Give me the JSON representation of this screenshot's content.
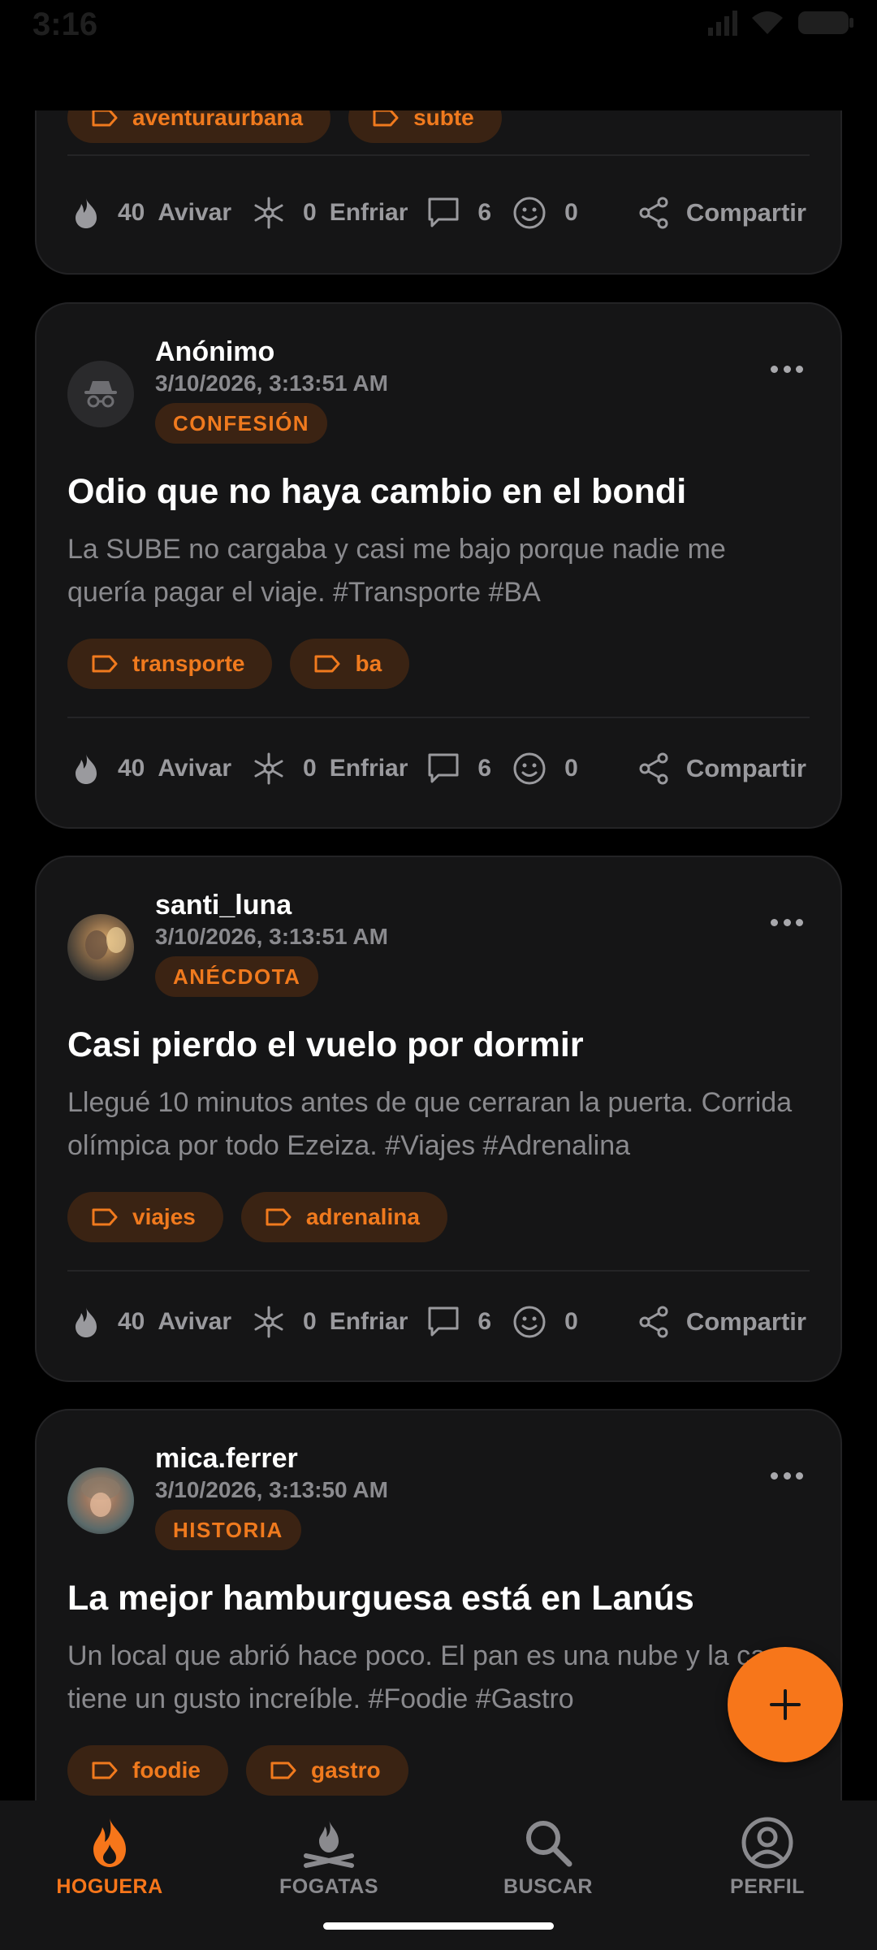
{
  "status_bar": {
    "time": "3:16"
  },
  "posts": [
    {
      "partial": true,
      "tags": [
        "aventuraurbana",
        "subte"
      ],
      "likes": "40",
      "like_label": "Avivar",
      "cools": "0",
      "cool_label": "Enfriar",
      "comments": "6",
      "reactions": "0",
      "share_label": "Compartir"
    },
    {
      "author": "Anónimo",
      "avatar": "incognito-icon",
      "timestamp": "3/10/2026, 3:13:51 AM",
      "category": "CONFESIÓN",
      "title": "Odio que no haya cambio en el bondi",
      "body": "La SUBE no cargaba y casi me bajo porque nadie me quería pagar el viaje. #Transporte #BA",
      "tags": [
        "transporte",
        "ba"
      ],
      "likes": "40",
      "like_label": "Avivar",
      "cools": "0",
      "cool_label": "Enfriar",
      "comments": "6",
      "reactions": "0",
      "share_label": "Compartir"
    },
    {
      "author": "santi_luna",
      "avatar": "user-photo",
      "timestamp": "3/10/2026, 3:13:51 AM",
      "category": "ANÉCDOTA",
      "title": "Casi pierdo el vuelo por dormir",
      "body": "Llegué 10 minutos antes de que cerraran la puerta. Corrida olímpica por todo Ezeiza. #Viajes #Adrenalina",
      "tags": [
        "viajes",
        "adrenalina"
      ],
      "likes": "40",
      "like_label": "Avivar",
      "cools": "0",
      "cool_label": "Enfriar",
      "comments": "6",
      "reactions": "0",
      "share_label": "Compartir"
    },
    {
      "author": "mica.ferrer",
      "avatar": "user-photo",
      "timestamp": "3/10/2026, 3:13:50 AM",
      "category": "HISTORIA",
      "title": "La mejor hamburguesa está en Lanús",
      "body": "Un local que abrió hace poco. El pan es una nube y la carne tiene un gusto increíble. #Foodie #Gastro",
      "tags": [
        "foodie",
        "gastro"
      ]
    }
  ],
  "bottom_nav": [
    {
      "label": "HOGUERA",
      "icon": "flame-icon",
      "active": true
    },
    {
      "label": "FOGATAS",
      "icon": "campfire-icon",
      "active": false
    },
    {
      "label": "BUSCAR",
      "icon": "search-icon",
      "active": false
    },
    {
      "label": "PERFIL",
      "icon": "profile-icon",
      "active": false
    }
  ],
  "colors": {
    "accent": "#f7761a",
    "background": "#000000",
    "card": "#151516",
    "muted": "#8a8a8e"
  }
}
